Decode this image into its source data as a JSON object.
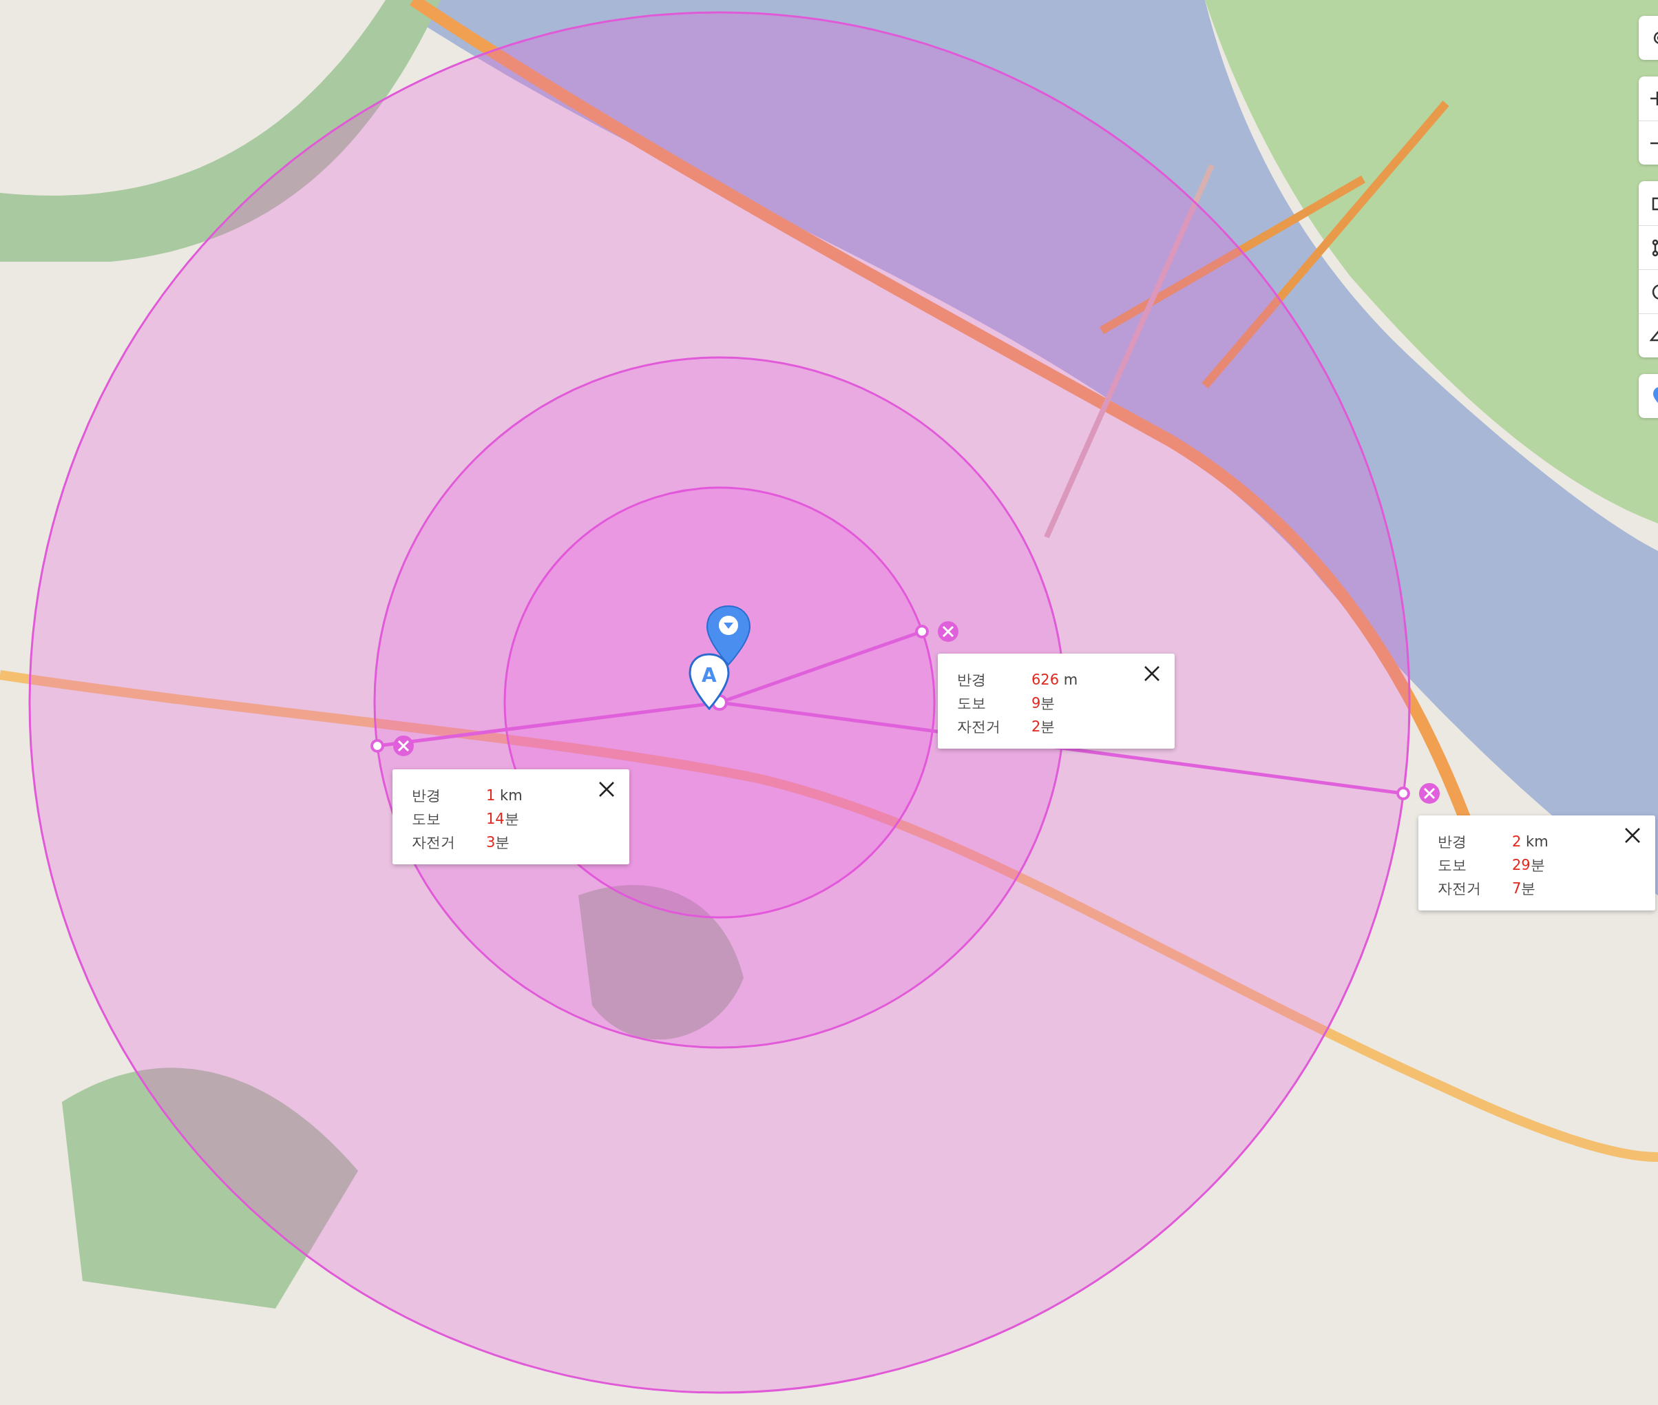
{
  "center_marker": {
    "label": "A"
  },
  "radius_rings": [
    {
      "radius_value": "626",
      "radius_unit": "m",
      "walk_value": "9",
      "walk_unit": "분",
      "bike_value": "2",
      "bike_unit": "분",
      "labels": [
        "반경",
        "도보",
        "자전거"
      ]
    },
    {
      "radius_value": "1",
      "radius_unit": "km",
      "walk_value": "14",
      "walk_unit": "분",
      "bike_value": "3",
      "bike_unit": "분",
      "labels": [
        "반경",
        "도보",
        "자전거"
      ]
    },
    {
      "radius_value": "2",
      "radius_unit": "km",
      "walk_value": "29",
      "walk_unit": "분",
      "bike_value": "7",
      "bike_unit": "분",
      "labels": [
        "반경",
        "도보",
        "자전거"
      ]
    }
  ],
  "map_controls": [
    {
      "kind": "locate"
    },
    {
      "kind": "zoom_in"
    },
    {
      "kind": "zoom_out"
    },
    {
      "kind": "area"
    },
    {
      "kind": "distance"
    },
    {
      "kind": "radius"
    },
    {
      "kind": "erase"
    },
    {
      "kind": "pin"
    }
  ]
}
